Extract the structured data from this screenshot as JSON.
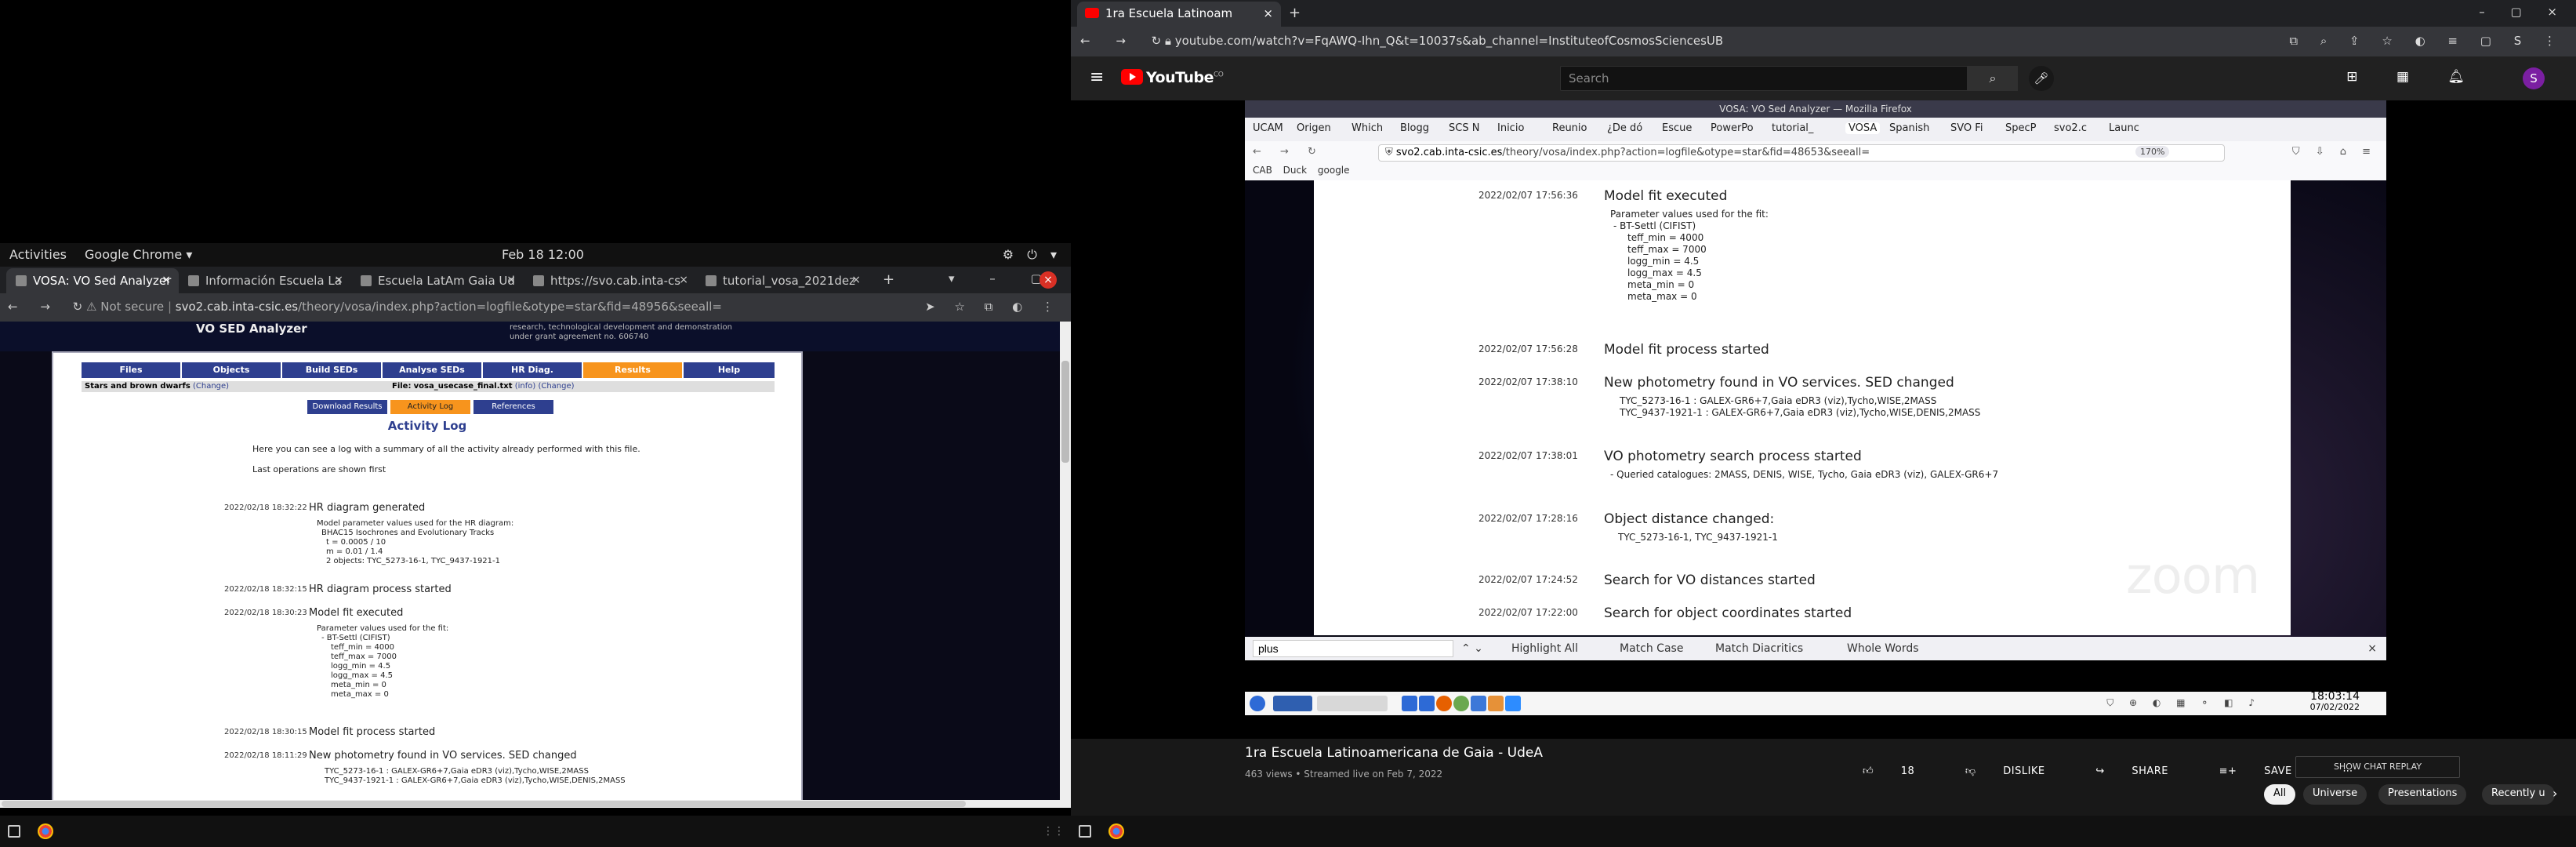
{
  "left": {
    "gnome": {
      "activities": "Activities",
      "app": "Google Chrome ▾",
      "clock": "Feb 18  12:00"
    },
    "tabs": [
      {
        "label": "VOSA: VO Sed Analyzer"
      },
      {
        "label": "Información Escuela La"
      },
      {
        "label": "Escuela LatAm Gaia Ud"
      },
      {
        "label": "https://svo.cab.inta-cs"
      },
      {
        "label": "tutorial_vosa_2021dez"
      }
    ],
    "url_secure": "Not secure",
    "url_host": "svo2.cab.inta-csic.es",
    "url_path": "/theory/vosa/index.php?action=logfile&otype=star&fid=48956&seeall=",
    "vosa": {
      "title": "VO SED Analyzer",
      "project_note": "research, technological development and demonstration under grant agreement no. 606740",
      "nav": [
        "Files",
        "Objects",
        "Build SEDs",
        "Analyse SEDs",
        "HR Diag.",
        "Results",
        "Help"
      ],
      "info_left": "Stars and brown dwarfs",
      "info_change": "(Change)",
      "info_file_label": "File:",
      "info_file": "vosa_usecase_final.txt",
      "info_file_links": "(info) (Change)",
      "subnav": [
        "Download Results",
        "Activity Log",
        "References"
      ],
      "log_title": "Activity Log",
      "intro1": "Here you can see a log with a summary of all the activity already performed with this file.",
      "intro2": "Last operations are shown first",
      "entries": [
        {
          "ts": "2022/02/18 18:32:22",
          "title": "HR diagram generated",
          "details": [
            "Model parameter values used for the HR diagram:",
            "BHAC15 Isochrones and Evolutionary Tracks",
            "t = 0.0005 / 10",
            "m = 0.01 / 1.4",
            "2 objects: TYC_5273-16-1, TYC_9437-1921-1"
          ]
        },
        {
          "ts": "2022/02/18 18:32:15",
          "title": "HR diagram process started",
          "details": []
        },
        {
          "ts": "2022/02/18 18:30:23",
          "title": "Model fit executed",
          "details": [
            "Parameter values used for the fit:",
            "BT-Settl (CIFIST)",
            "teff_min = 4000",
            "teff_max = 7000",
            "logg_min = 4.5",
            "logg_max = 4.5",
            "meta_min = 0",
            "meta_max = 0"
          ]
        },
        {
          "ts": "2022/02/18 18:30:15",
          "title": "Model fit process started",
          "details": []
        },
        {
          "ts": "2022/02/18 18:11:29",
          "title": "New photometry found in VO services. SED changed",
          "details": [
            "TYC_5273-16-1 : GALEX-GR6+7,Gaia eDR3 (viz),Tycho,WISE,2MASS",
            "TYC_9437-1921-1 : GALEX-GR6+7,Gaia eDR3 (viz),Tycho,WISE,DENIS,2MASS"
          ]
        }
      ]
    }
  },
  "right": {
    "tab_title": "1ra Escuela Latinoam",
    "url": "youtube.com/watch?v=FqAWQ-Ihn_Q&t=10037s&ab_channel=InstituteofCosmosSciencesUB",
    "search_placeholder": "Search",
    "logo": "YouTube",
    "logo_sup": "CO",
    "avatar": "S",
    "inner": {
      "window_title": "VOSA: VO Sed Analyzer — Mozilla Firefox",
      "tabs": [
        "UCAM",
        "Origen",
        "Which",
        "Blogg",
        "SCS N",
        "Inicio",
        "Reunio",
        "¿De dó",
        "Escue",
        "PowerPo",
        "tutorial_",
        "VOSA",
        "Spanish",
        "SVO Fi",
        "SpecP",
        "svo2.c",
        "Launc"
      ],
      "url_host": "svo2.cab.inta-csic.es",
      "url_path": "/theory/vosa/index.php?action=logfile&otype=star&fid=48653&seeall=",
      "zoom": "170%",
      "bookmarks": [
        "CAB",
        "Duck",
        "google"
      ],
      "entries": [
        {
          "ts": "2022/02/07 17:56:36",
          "title": "Model fit executed",
          "details": [
            "Parameter values used for the fit:",
            "BT-Settl (CIFIST)",
            "teff_min = 4000",
            "teff_max = 7000",
            "logg_min = 4.5",
            "logg_max = 4.5",
            "meta_min = 0",
            "meta_max = 0"
          ]
        },
        {
          "ts": "2022/02/07 17:56:28",
          "title": "Model fit process started",
          "details": []
        },
        {
          "ts": "2022/02/07 17:38:10",
          "title": "New photometry found in VO services. SED changed",
          "details": [
            "TYC_5273-16-1 : GALEX-GR6+7,Gaia eDR3 (viz),Tycho,WISE,2MASS",
            "TYC_9437-1921-1 : GALEX-GR6+7,Gaia eDR3 (viz),Tycho,WISE,DENIS,2MASS"
          ]
        },
        {
          "ts": "2022/02/07 17:38:01",
          "title": "VO photometry search process started",
          "details": [
            "- Queried catalogues: 2MASS, DENIS, WISE, Tycho, Gaia eDR3 (viz), GALEX-GR6+7"
          ]
        },
        {
          "ts": "2022/02/07 17:28:16",
          "title": "Object distance changed:",
          "details": [
            "TYC_5273-16-1, TYC_9437-1921-1"
          ]
        },
        {
          "ts": "2022/02/07 17:24:52",
          "title": "Search for VO distances started",
          "details": []
        },
        {
          "ts": "2022/02/07 17:22:00",
          "title": "Search for object coordinates started",
          "details": []
        }
      ],
      "find_value": "plus",
      "find_opts": [
        "Highlight All",
        "Match Case",
        "Match Diacritics",
        "Whole Words"
      ],
      "clock_time": "18:03:14",
      "clock_date": "07/02/2022",
      "watermark": "zoom"
    },
    "video": {
      "title": "1ra Escuela Latinoamericana de Gaia - UdeA",
      "meta": "463 views • Streamed live on Feb 7, 2022",
      "likes": "18",
      "dislike": "DISLIKE",
      "share": "SHARE",
      "save": "SAVE",
      "chat_replay": "SHOW CHAT REPLAY",
      "chips": [
        "All",
        "Universe",
        "Presentations",
        "Recently u"
      ]
    }
  }
}
